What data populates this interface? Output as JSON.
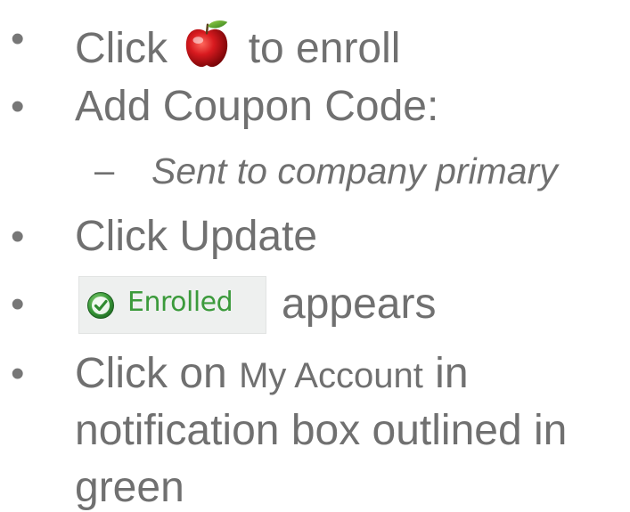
{
  "bullets": {
    "symbol": "•",
    "sub_symbol": "–"
  },
  "items": [
    {
      "text_before": "Click",
      "icon": "apple-icon",
      "text_after": "to enroll"
    },
    {
      "text": "Add Coupon Code:"
    },
    {
      "sub_text": "Sent to company primary"
    },
    {
      "text": "Click Update"
    },
    {
      "badge_label": "Enrolled",
      "badge_icon": "check-circle-icon",
      "text_after": "appears"
    },
    {
      "text_before": "Click on",
      "highlight": "My Account",
      "text_after": "in",
      "line2": "notification box outlined in",
      "line3": "green"
    }
  ],
  "colors": {
    "text": "#707070",
    "badge_text": "#3b9a3b",
    "badge_bg": "#eef0ef",
    "apple_red": "#c8141a",
    "check_green": "#3a9a3a"
  }
}
